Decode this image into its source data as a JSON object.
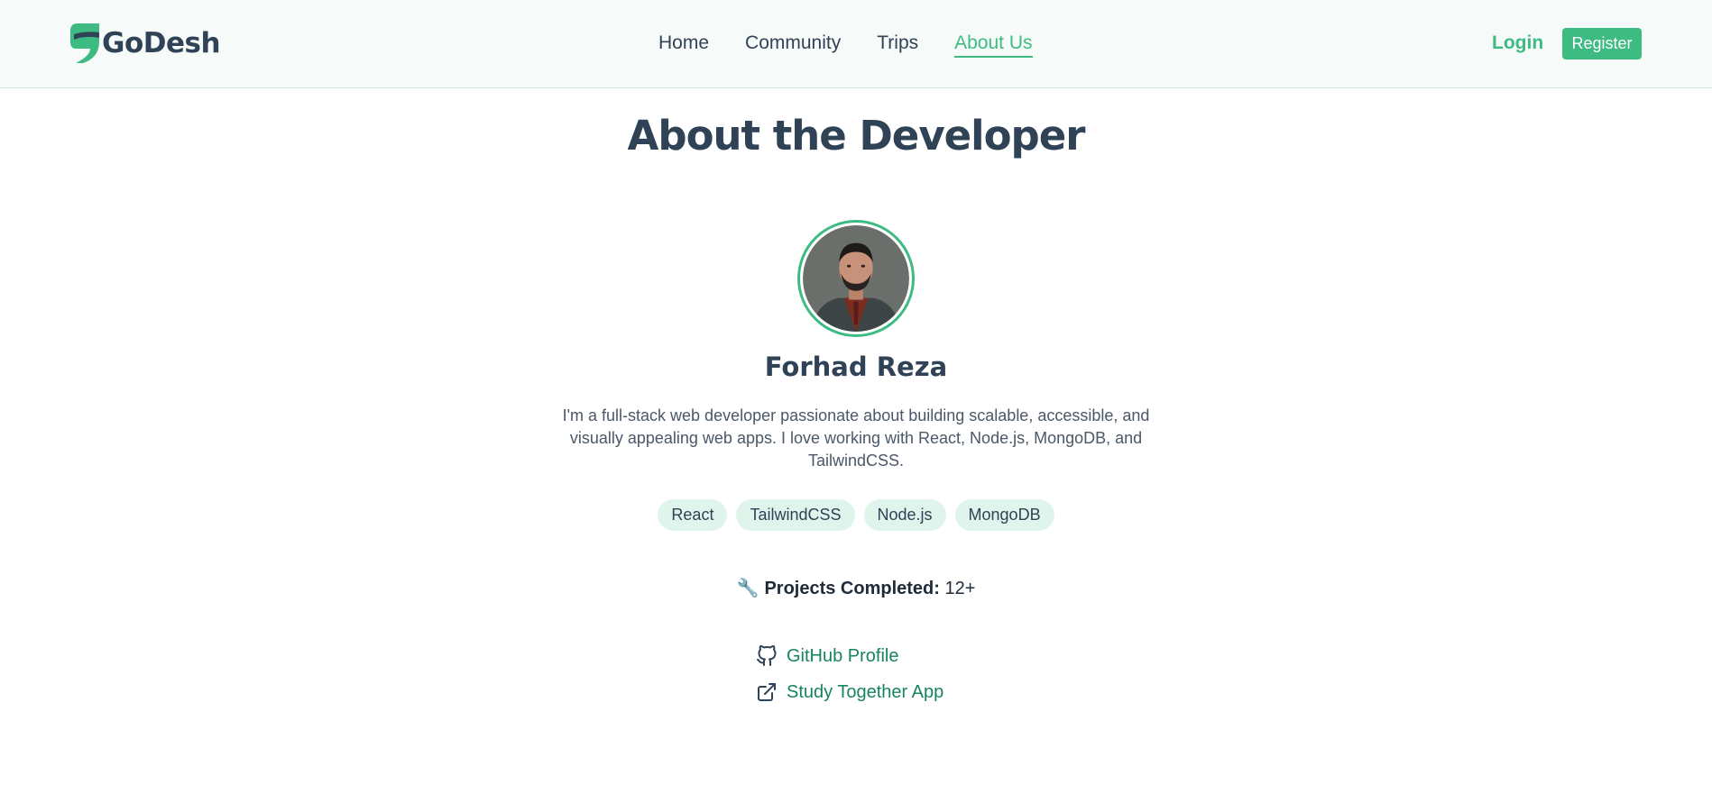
{
  "brand": {
    "name": "GoDesh"
  },
  "nav": {
    "items": [
      {
        "label": "Home",
        "active": false
      },
      {
        "label": "Community",
        "active": false
      },
      {
        "label": "Trips",
        "active": false
      },
      {
        "label": "About Us",
        "active": true
      }
    ],
    "login_label": "Login",
    "register_label": "Register"
  },
  "page": {
    "title": "About the Developer"
  },
  "developer": {
    "name": "Forhad Reza",
    "bio": "I'm a full-stack web developer passionate about building scalable, accessible, and visually appealing web apps. I love working with React, Node.js, MongoDB, and TailwindCSS.",
    "skills": [
      "React",
      "TailwindCSS",
      "Node.js",
      "MongoDB"
    ],
    "projects": {
      "icon": "wrench-icon",
      "label": "Projects Completed:",
      "value": "12+"
    },
    "links": [
      {
        "icon": "github-icon",
        "label": "GitHub Profile"
      },
      {
        "icon": "external-link-icon",
        "label": "Study Together App"
      }
    ]
  },
  "colors": {
    "accent": "#3dbb82",
    "link": "#17855c",
    "heading": "#2f4256",
    "tag_bg": "#dff5ec",
    "nav_bg": "#f6faf9"
  }
}
